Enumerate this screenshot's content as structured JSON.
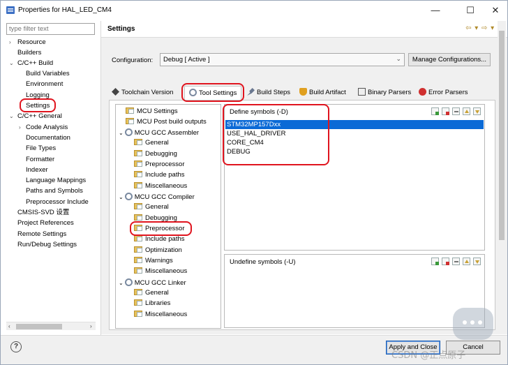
{
  "window": {
    "title": "Properties for HAL_LED_CM4",
    "minimize": "—",
    "maximize": "☐",
    "close": "✕"
  },
  "filter": {
    "placeholder": "type filter text"
  },
  "tree": [
    {
      "label": "Resource",
      "arrow": "›"
    },
    {
      "label": "Builders"
    },
    {
      "label": "C/C++ Build",
      "arrow": "⌄"
    },
    {
      "label": "Build Variables"
    },
    {
      "label": "Environment"
    },
    {
      "label": "Logging"
    },
    {
      "label": "Settings"
    },
    {
      "label": "C/C++ General",
      "arrow": "⌄"
    },
    {
      "label": "Code Analysis",
      "arrow": "›"
    },
    {
      "label": "Documentation"
    },
    {
      "label": "File Types"
    },
    {
      "label": "Formatter"
    },
    {
      "label": "Indexer"
    },
    {
      "label": "Language Mappings"
    },
    {
      "label": "Paths and Symbols"
    },
    {
      "label": "Preprocessor Include"
    },
    {
      "label": "CMSIS-SVD 设置"
    },
    {
      "label": "Project References"
    },
    {
      "label": "Remote Settings"
    },
    {
      "label": "Run/Debug Settings"
    }
  ],
  "header": {
    "title": "Settings",
    "nav": "⇦ ▾ ⇨ ▾ ▾"
  },
  "config": {
    "label": "Configuration:",
    "value": "Debug  [ Active ]",
    "manage": "Manage Configurations..."
  },
  "tabs": [
    "Toolchain Version",
    "Tool Settings",
    "Build Steps",
    "Build Artifact",
    "Binary Parsers",
    "Error Parsers"
  ],
  "tool_tree": [
    "MCU Settings",
    "MCU Post build outputs",
    "MCU GCC Assembler",
    "General",
    "Debugging",
    "Preprocessor",
    "Include paths",
    "Miscellaneous",
    "MCU GCC Compiler",
    "General",
    "Debugging",
    "Preprocessor",
    "Include paths",
    "Optimization",
    "Warnings",
    "Miscellaneous",
    "MCU GCC Linker",
    "General",
    "Libraries",
    "Miscellaneous"
  ],
  "define_symbols": {
    "label": "Define symbols (-D)",
    "items": [
      "STM32MP157Dxx",
      "USE_HAL_DRIVER",
      "CORE_CM4",
      "DEBUG"
    ]
  },
  "undefine_symbols": {
    "label": "Undefine symbols (-U)"
  },
  "footer": {
    "help": "?",
    "apply_close": "Apply and Close",
    "cancel": "Cancel"
  },
  "watermark": "CSDN @正点原子"
}
